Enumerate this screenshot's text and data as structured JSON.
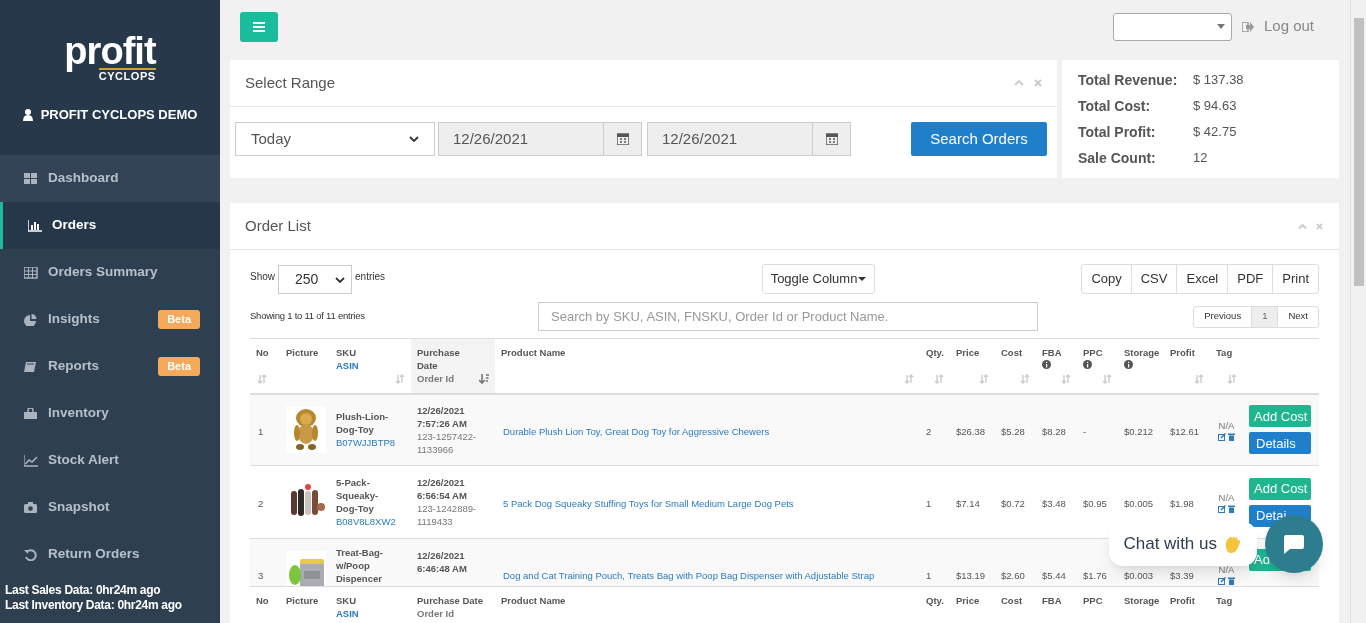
{
  "sidebar": {
    "logo": {
      "word": "profit",
      "sub": "CYCLOPS"
    },
    "user": "PROFIT CYCLOPS DEMO",
    "items": [
      {
        "label": "Dashboard",
        "selected": false
      },
      {
        "label": "Orders",
        "selected": true
      },
      {
        "label": "Orders Summary",
        "selected": false
      },
      {
        "label": "Insights",
        "selected": false,
        "badge": "Beta"
      },
      {
        "label": "Reports",
        "selected": false,
        "badge": "Beta"
      },
      {
        "label": "Inventory",
        "selected": false
      },
      {
        "label": "Stock Alert",
        "selected": false
      },
      {
        "label": "Snapshot",
        "selected": false
      },
      {
        "label": "Return Orders",
        "selected": false
      }
    ],
    "status": [
      "Last Sales Data: 0hr24m ago",
      "Last Inventory Data: 0hr24m ago"
    ]
  },
  "topbar": {
    "logout": "Log out"
  },
  "select_range": {
    "title": "Select Range",
    "range": "Today",
    "date_from": "12/26/2021",
    "date_to": "12/26/2021",
    "button": "Search Orders"
  },
  "totals": [
    {
      "label": "Total Revenue:",
      "value": "$ 137.38"
    },
    {
      "label": "Total Cost:",
      "value": "$ 94.63"
    },
    {
      "label": "Total Profit:",
      "value": "$ 42.75"
    },
    {
      "label": "Sale Count:",
      "value": "12"
    }
  ],
  "order_list": {
    "title": "Order List",
    "show_label": "Show",
    "page_size": "250",
    "entries_label": "entries",
    "info": "Showing 1 to 11 of 11 entries",
    "toggle_column": "Toggle Column",
    "search": {
      "placeholder": "Search by SKU, ASIN, FNSKU, Order Id or Product Name."
    },
    "export_buttons": [
      "Copy",
      "CSV",
      "Excel",
      "PDF",
      "Print"
    ],
    "pagination": [
      {
        "label": "Previous",
        "selected": false
      },
      {
        "label": "1",
        "selected": true
      },
      {
        "label": "Next",
        "selected": false
      }
    ],
    "columns": [
      {
        "label": "No",
        "sortable": true,
        "sorted": false
      },
      {
        "label": "Picture",
        "sortable": false,
        "sorted": false
      },
      {
        "label": "SKU",
        "sub": "ASIN",
        "sortable": true,
        "sorted": false
      },
      {
        "label": "Purchase Date",
        "sub": "Order Id",
        "sortable": true,
        "sorted": true
      },
      {
        "label": "Product Name",
        "sortable": true,
        "sorted": false
      },
      {
        "label": "Qty.",
        "sortable": true,
        "sorted": false
      },
      {
        "label": "Price",
        "sortable": true,
        "sorted": false
      },
      {
        "label": "Cost",
        "sortable": true,
        "sorted": false
      },
      {
        "label": "FBA",
        "info": true,
        "sortable": true,
        "sorted": false
      },
      {
        "label": "PPC",
        "info": true,
        "sortable": true,
        "sorted": false
      },
      {
        "label": "Storage",
        "info": true,
        "sortable": false,
        "sorted": false
      },
      {
        "label": "Profit",
        "sortable": true,
        "sorted": false
      },
      {
        "label": "Tag",
        "sortable": true,
        "sorted": false
      }
    ],
    "footer_columns": [
      {
        "label": "No"
      },
      {
        "label": "Picture"
      },
      {
        "label": "SKU",
        "sub": "ASIN"
      },
      {
        "label": "Purchase Date",
        "sub": "Order Id"
      },
      {
        "label": "Product Name"
      },
      {
        "label": "Qty."
      },
      {
        "label": "Price"
      },
      {
        "label": "Cost"
      },
      {
        "label": "FBA"
      },
      {
        "label": "PPC"
      },
      {
        "label": "Storage"
      },
      {
        "label": "Profit"
      },
      {
        "label": "Tag"
      }
    ],
    "rows": [
      {
        "no": "1",
        "sku": "Plush-Lion-Dog-Toy",
        "asin": "B07WJJBTP8",
        "date": "12/26/2021",
        "time": "7:57:26 AM",
        "order_id": "123-1257422-1133966",
        "product": "Durable Plush Lion Toy, Great Dog Toy for Aggressive Chewers",
        "qty": "2",
        "price": "$26.38",
        "cost": "$5.28",
        "fba": "$8.28",
        "ppc": "-",
        "storage": "$0.212",
        "profit": "$12.61",
        "tag": "N/A",
        "buttons": [
          "Add Cost",
          "Details"
        ]
      },
      {
        "no": "2",
        "sku": "5-Pack-Squeaky-Dog-Toy",
        "asin": "B08V8L8XW2",
        "date": "12/26/2021",
        "time": "6:56:54 AM",
        "order_id": "123-1242889-1119433",
        "product": "5 Pack Dog Squeaky Stuffing Toys for Small Medium Large Dog Pets",
        "qty": "1",
        "price": "$7.14",
        "cost": "$0.72",
        "fba": "$3.48",
        "ppc": "$0.95",
        "storage": "$0.005",
        "profit": "$1.98",
        "tag": "N/A",
        "buttons": [
          "Add Cost",
          "Detai"
        ]
      },
      {
        "no": "3",
        "sku": "Treat-Bag-w/Poop Dispencer",
        "date": "12/26/2021",
        "time": "6:46:48 AM",
        "product": "Dog and Cat Training Pouch, Treats Bag with Poop Bag Dispenser with Adjustable Strap",
        "qty": "1",
        "price": "$13.19",
        "cost": "$2.60",
        "fba": "$5.44",
        "ppc": "$1.76",
        "storage": "$0.003",
        "profit": "$3.39",
        "tag": "N/A",
        "buttons": [
          "Ad"
        ]
      }
    ]
  },
  "chat": {
    "label": "Chat with us"
  }
}
